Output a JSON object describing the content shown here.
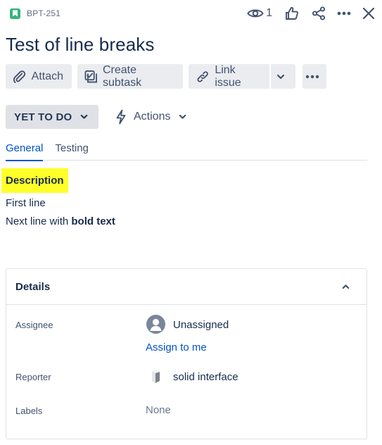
{
  "header": {
    "issue_key": "BPT-251",
    "watch_count": "1",
    "icons": [
      "bookmark-icon",
      "eye-icon",
      "thumbs-up-icon",
      "share-icon",
      "more-icon",
      "close-icon"
    ]
  },
  "title": "Test of line breaks",
  "toolbar": {
    "attach_label": "Attach",
    "create_subtask_label": "Create subtask",
    "link_issue_label": "Link issue"
  },
  "status": {
    "label": "YET TO DO",
    "actions_label": "Actions"
  },
  "tabs": [
    {
      "label": "General",
      "active": true
    },
    {
      "label": "Testing",
      "active": false
    }
  ],
  "description": {
    "heading": "Description",
    "line1": "First line",
    "line2_prefix": "Next line with ",
    "line2_bold": "bold text"
  },
  "details": {
    "heading": "Details",
    "assignee_label": "Assignee",
    "assignee_value": "Unassigned",
    "assign_to_me": "Assign to me",
    "reporter_label": "Reporter",
    "reporter_value": "solid interface",
    "labels_label": "Labels",
    "labels_value": "None"
  },
  "colors": {
    "accent": "#0052cc",
    "highlight": "#ffff2a",
    "issue_type": "#36b37e"
  }
}
